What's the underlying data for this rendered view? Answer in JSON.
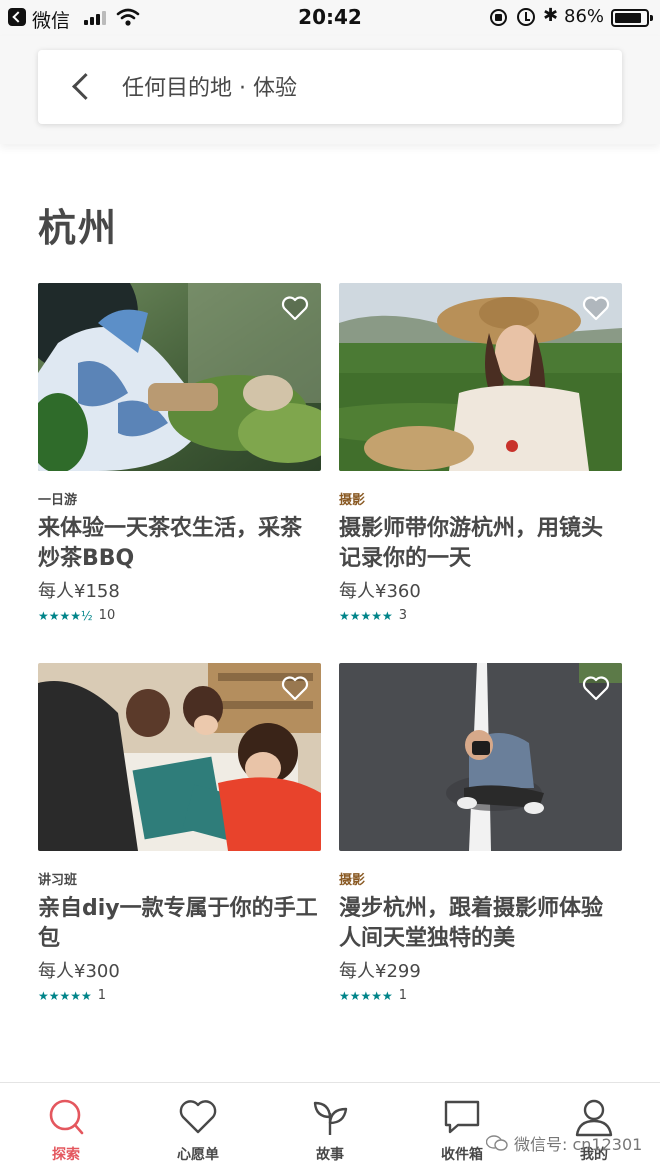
{
  "status_bar": {
    "back_app_name": "微信",
    "time": "20:42",
    "battery_percent": "86%",
    "bluetooth_glyph": "✱",
    "signal_bars": 3,
    "battery_level": 0.86
  },
  "header": {
    "query": "任何目的地 · 体验"
  },
  "section": {
    "city": "杭州"
  },
  "colors": {
    "accent_red": "#e4575e",
    "star_teal": "#008489",
    "text": "#484848"
  },
  "cards": [
    {
      "category": "一日游",
      "title": "来体验一天茶农生活，采茶炒茶BBQ",
      "price": "每人¥158",
      "stars": "★★★★½",
      "rating_value": 4.5,
      "reviews": "10",
      "favorite_icon": "heart-outline-icon"
    },
    {
      "category": "摄影",
      "title": "摄影师带你游杭州，用镜头记录你的一天",
      "price": "每人¥360",
      "stars": "★★★★★",
      "rating_value": 5,
      "reviews": "3",
      "favorite_icon": "heart-outline-icon"
    },
    {
      "category": "讲习班",
      "title": "亲自diy一款专属于你的手工包",
      "price": "每人¥300",
      "stars": "★★★★★",
      "rating_value": 5,
      "reviews": "1",
      "favorite_icon": "heart-outline-icon"
    },
    {
      "category": "摄影",
      "title": "漫步杭州，跟着摄影师体验人间天堂独特的美",
      "price": "每人¥299",
      "stars": "★★★★★",
      "rating_value": 5,
      "reviews": "1",
      "favorite_icon": "heart-outline-icon"
    }
  ],
  "tabs": [
    {
      "label": "探索",
      "icon": "search-icon",
      "active": true
    },
    {
      "label": "心愿单",
      "icon": "heart-icon",
      "active": false
    },
    {
      "label": "故事",
      "icon": "sprout-icon",
      "active": false
    },
    {
      "label": "收件箱",
      "icon": "chat-bubble-icon",
      "active": false
    },
    {
      "label": "我的",
      "icon": "profile-icon",
      "active": false
    }
  ],
  "watermark": {
    "text": "微信号: cn12301",
    "icon": "wechat-icon"
  }
}
